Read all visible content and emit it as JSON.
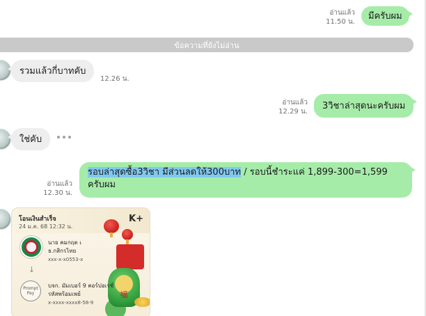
{
  "messages": {
    "m1": {
      "text": "มีครับผม",
      "read": "อ่านแล้ว",
      "time": "11.50 น."
    },
    "unread_divider": "ข้อความที่ยังไม่อ่าน",
    "m2": {
      "text": "รวมแล้วกี่บาทคับ",
      "time": "12.26 น."
    },
    "m3": {
      "text": "3วิชาล่าสุดนะครับผม",
      "read": "อ่านแล้ว",
      "time": "12.29 น."
    },
    "m4": {
      "text": "ใช่คับ"
    },
    "m5": {
      "highlight": "รอบล่าสุดซื้อ3วิชา มีส่วนลดให้300บาท",
      "rest": " / รอบนี้ชำระแค่ 1,899-300=1,599 ครับผม",
      "read": "อ่านแล้ว",
      "time": "12.30 น."
    },
    "slip": {
      "title": "โอนเงินสำเร็จ",
      "date": "24 ม.ค. 68   12:32 น.",
      "sender_name": "นาย คมกฤต เ",
      "sender_bank": "ธ.กสิกรไทย",
      "sender_account": "xxx-x-x0553-x",
      "receiver_name": "บจก. มัมเบอร์ 9 คอร์ปอเรชั่",
      "receiver_label": "รหัสพร้อมเพย์",
      "receiver_account": "x-xxxx-xxxx8-58-9",
      "brand": "K+",
      "promptpay": "Prompt Pay"
    }
  },
  "colors": {
    "outgoing_bubble": "#a6eca9",
    "incoming_bubble": "#eeeeef",
    "divider": "#c9c9c9",
    "selection_highlight": "#7fc8f0"
  },
  "icons": {
    "avatar": "contact-avatar",
    "typing": "typing-dots-icon",
    "kbank": "kasikorn-logo-icon",
    "promptpay": "promptpay-logo-icon",
    "arrow": "arrow-down-icon"
  }
}
